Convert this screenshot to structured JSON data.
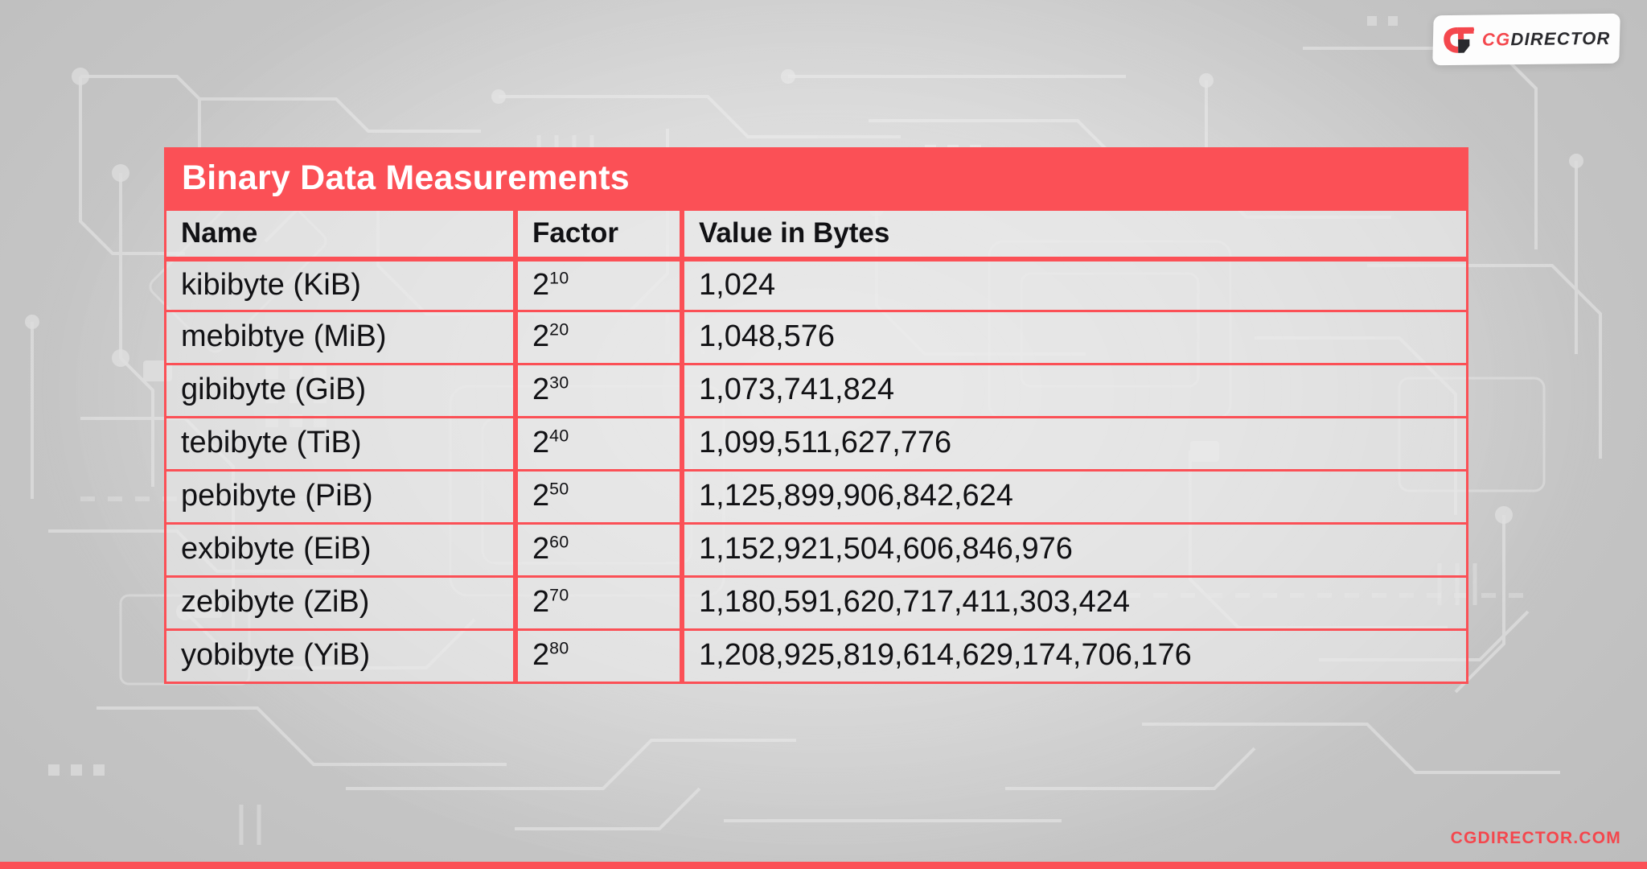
{
  "brand": {
    "logo_mark": "cgdirector-g-mark-icon",
    "logo_text_primary": "CG",
    "logo_text_secondary": "DIRECTOR",
    "footer_url": "CGDIRECTOR.COM",
    "accent_color": "#FB5056",
    "logo_dark_color": "#2A2A2E",
    "background_color": "#C9C9C9"
  },
  "table": {
    "title": "Binary Data Measurements",
    "columns": [
      "Name",
      "Factor",
      "Value in Bytes"
    ],
    "rows": [
      {
        "name": "kibibyte (KiB)",
        "factor_base": "2",
        "factor_exp": "10",
        "value": "1,024"
      },
      {
        "name": "mebibtye (MiB)",
        "factor_base": "2",
        "factor_exp": "20",
        "value": "1,048,576"
      },
      {
        "name": "gibibyte (GiB)",
        "factor_base": "2",
        "factor_exp": "30",
        "value": "1,073,741,824"
      },
      {
        "name": "tebibyte (TiB)",
        "factor_base": "2",
        "factor_exp": "40",
        "value": "1,099,511,627,776"
      },
      {
        "name": "pebibyte (PiB)",
        "factor_base": "2",
        "factor_exp": "50",
        "value": "1,125,899,906,842,624"
      },
      {
        "name": "exbibyte (EiB)",
        "factor_base": "2",
        "factor_exp": "60",
        "value": "1,152,921,504,606,846,976"
      },
      {
        "name": "zebibyte (ZiB)",
        "factor_base": "2",
        "factor_exp": "70",
        "value": "1,180,591,620,717,411,303,424"
      },
      {
        "name": "yobibyte (YiB)",
        "factor_base": "2",
        "factor_exp": "80",
        "value": "1,208,925,819,614,629,174,706,176"
      }
    ]
  }
}
